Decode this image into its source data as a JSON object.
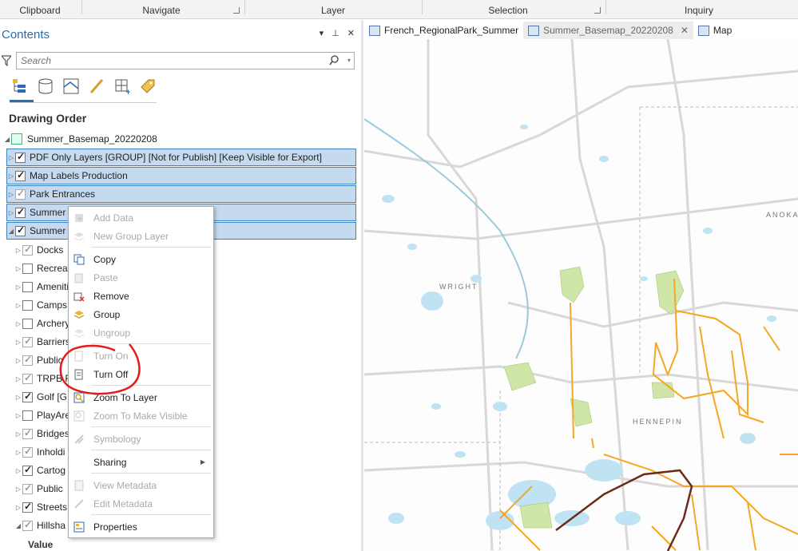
{
  "ribbon": {
    "groups": [
      "Clipboard",
      "Navigate",
      "Layer",
      "Selection",
      "Inquiry"
    ]
  },
  "contents": {
    "title": "Contents",
    "ctrl_dropdown": "▾",
    "ctrl_pin": "⊥",
    "ctrl_close": "✕",
    "search_placeholder": "Search",
    "drawing_order": "Drawing Order",
    "tools": [
      "list-by-drawing-order-icon",
      "list-by-source-icon",
      "list-by-selection-icon",
      "list-by-editing-icon",
      "list-by-snapping-icon",
      "list-by-labeling-icon"
    ],
    "map_name": "Summer_Basemap_20220208",
    "layers": [
      {
        "label": "PDF Only Layers [GROUP] [Not for Publish] [Keep Visible for Export]",
        "checked": true,
        "selected": true
      },
      {
        "label": "Map Labels Production",
        "checked": true,
        "selected": true
      },
      {
        "label": "Park Entrances",
        "checked": true,
        "selected": true,
        "grey": true
      },
      {
        "label": "Summer",
        "checked": true,
        "selected": true
      },
      {
        "label": "Summer",
        "checked": true,
        "selected": true,
        "expanded": true
      }
    ],
    "sublayers": [
      {
        "label": "Docks",
        "checked": true,
        "grey": true
      },
      {
        "label": "Recreat",
        "checked": false
      },
      {
        "label": "Ameniti",
        "checked": false
      },
      {
        "label": "Camps",
        "checked": false
      },
      {
        "label": "Archery",
        "checked": false
      },
      {
        "label": "Barriers",
        "checked": true,
        "grey": true
      },
      {
        "label": "Public",
        "checked": true,
        "grey": true
      },
      {
        "label": "TRPB F",
        "checked": true,
        "grey": true
      },
      {
        "label": "Golf [G",
        "checked": true
      },
      {
        "label": "PlayAre",
        "checked": false
      },
      {
        "label": "Bridges",
        "checked": true,
        "grey": true
      },
      {
        "label": "Inholdi",
        "checked": true,
        "grey": true
      },
      {
        "label": "Cartog",
        "checked": true
      },
      {
        "label": "Public",
        "checked": true,
        "grey": true
      },
      {
        "label": "Streets",
        "checked": true
      },
      {
        "label": "Hillsha",
        "checked": true,
        "grey": true
      }
    ],
    "value_label": "Value"
  },
  "tabs": [
    {
      "label": "French_RegionalPark_Summer",
      "active": false
    },
    {
      "label": "Summer_Basemap_20220208",
      "active": true,
      "close": "✕"
    },
    {
      "label": "Map",
      "active": false
    }
  ],
  "map": {
    "labels": [
      "WRIGHT",
      "HENNEPIN",
      "ANOKA"
    ]
  },
  "context_menu": {
    "items": [
      {
        "label": "Add Data",
        "disabled": true,
        "icon": "add-data-icon"
      },
      {
        "label": "New Group Layer",
        "disabled": true,
        "icon": "new-group-layer-icon"
      },
      {
        "label": "Copy",
        "disabled": false,
        "icon": "copy-icon"
      },
      {
        "label": "Paste",
        "disabled": true,
        "icon": "paste-icon"
      },
      {
        "label": "Remove",
        "disabled": false,
        "icon": "remove-icon"
      },
      {
        "label": "Group",
        "disabled": false,
        "icon": "group-icon"
      },
      {
        "label": "Ungroup",
        "disabled": true,
        "icon": "ungroup-icon"
      },
      {
        "label": "Turn On",
        "disabled": true,
        "icon": "turn-on-icon"
      },
      {
        "label": "Turn Off",
        "disabled": false,
        "icon": "turn-off-icon"
      },
      {
        "label": "Zoom To Layer",
        "disabled": false,
        "icon": "zoom-to-layer-icon"
      },
      {
        "label": "Zoom To Make Visible",
        "disabled": true,
        "icon": "zoom-to-make-visible-icon"
      },
      {
        "label": "Symbology",
        "disabled": true,
        "icon": "symbology-icon"
      },
      {
        "label": "Sharing",
        "disabled": false,
        "icon": "",
        "submenu": "▶"
      },
      {
        "label": "View Metadata",
        "disabled": true,
        "icon": "view-metadata-icon"
      },
      {
        "label": "Edit Metadata",
        "disabled": true,
        "icon": "edit-metadata-icon"
      },
      {
        "label": "Properties",
        "disabled": false,
        "icon": "properties-icon"
      }
    ]
  },
  "colors": {
    "accent": "#2b6cb0",
    "selection": "#c5daee",
    "annotation_red": "#e41b1b",
    "trail_orange": "#f5a623",
    "rail_brown": "#6b2a1a",
    "water": "#bfe3f2",
    "park_green": "#cfe6a8"
  }
}
